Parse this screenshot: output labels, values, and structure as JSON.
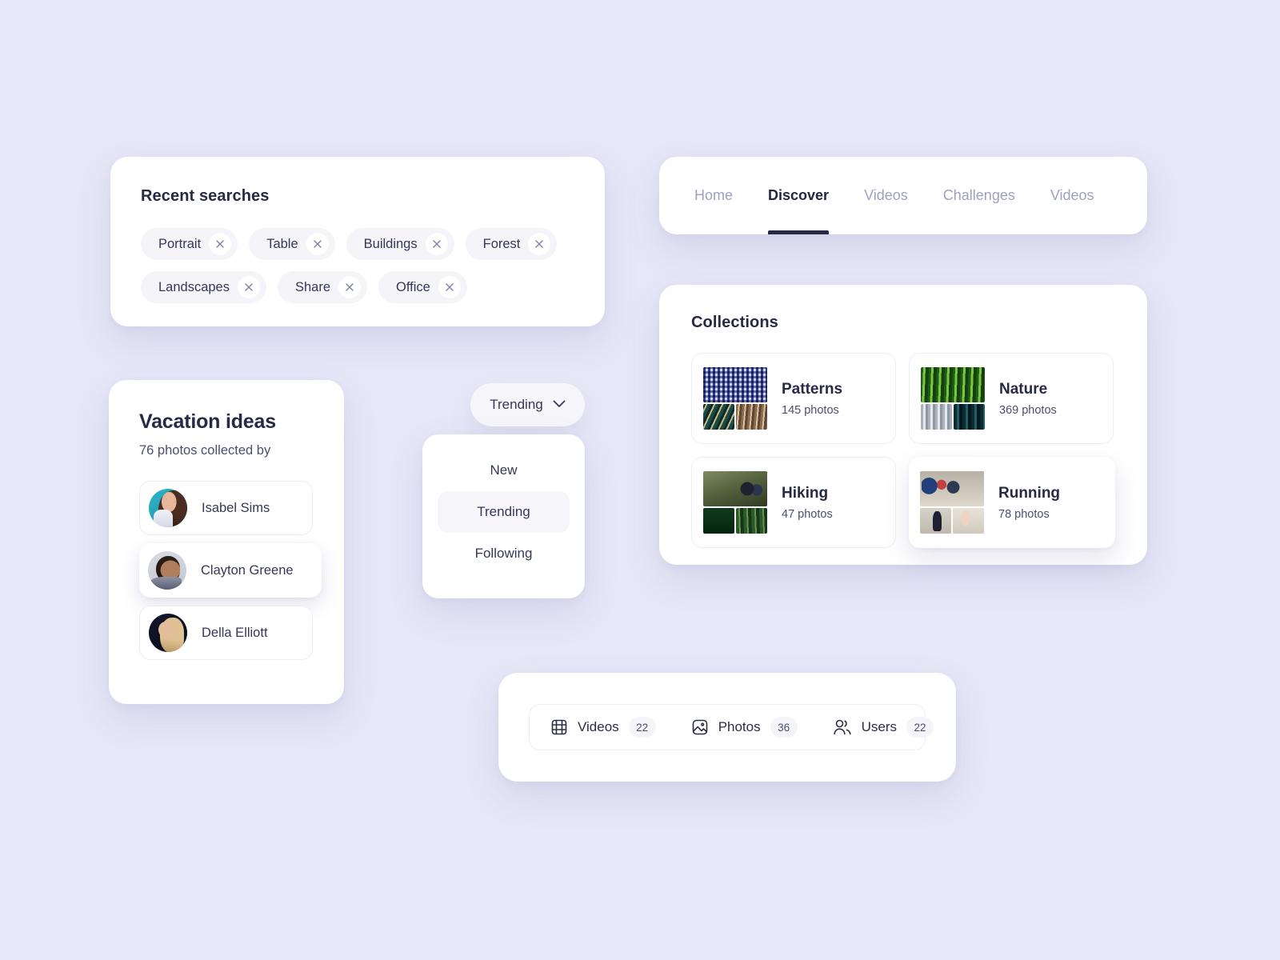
{
  "theme": {
    "background": "#e7e7f8",
    "card_background": "#ffffff",
    "text_primary": "#262a45",
    "text_secondary": "#4a4f6e",
    "text_muted": "#9ea2c0",
    "chip_background": "#f4f4f9",
    "accent": "#262a45"
  },
  "recent_searches": {
    "title": "Recent searches",
    "chips": [
      {
        "label": "Portrait",
        "close_icon": "close-icon"
      },
      {
        "label": "Table",
        "close_icon": "close-icon"
      },
      {
        "label": "Buildings",
        "close_icon": "close-icon"
      },
      {
        "label": "Forest",
        "close_icon": "close-icon"
      },
      {
        "label": "Landscapes",
        "close_icon": "close-icon"
      },
      {
        "label": "Share",
        "close_icon": "close-icon"
      },
      {
        "label": "Office",
        "close_icon": "close-icon"
      }
    ]
  },
  "vacation": {
    "title": "Vacation ideas",
    "subtitle": "76 photos collected by",
    "people": [
      {
        "name": "Isabel Sims",
        "avatar": "avatar-isabel-sims"
      },
      {
        "name": "Clayton Greene",
        "avatar": "avatar-clayton-greene"
      },
      {
        "name": "Della Elliott",
        "avatar": "avatar-della-elliott"
      }
    ]
  },
  "sort": {
    "selected": "Trending",
    "chevron_icon": "chevron-down-icon",
    "options": [
      {
        "label": "New",
        "selected": false
      },
      {
        "label": "Trending",
        "selected": true
      },
      {
        "label": "Following",
        "selected": false
      }
    ]
  },
  "nav": {
    "tabs": [
      {
        "label": "Home",
        "active": false
      },
      {
        "label": "Discover",
        "active": true
      },
      {
        "label": "Videos",
        "active": false
      },
      {
        "label": "Challenges",
        "active": false
      },
      {
        "label": "Videos",
        "active": false
      }
    ]
  },
  "collections": {
    "title": "Collections",
    "items": [
      {
        "name": "Patterns",
        "count": "145 photos",
        "thumb": "thumb-patterns"
      },
      {
        "name": "Nature",
        "count": "369 photos",
        "thumb": "thumb-nature"
      },
      {
        "name": "Hiking",
        "count": "47 photos",
        "thumb": "thumb-hiking"
      },
      {
        "name": "Running",
        "count": "78 photos",
        "thumb": "thumb-running"
      }
    ]
  },
  "filters": {
    "items": [
      {
        "label": "Videos",
        "count": "22",
        "icon": "film-icon"
      },
      {
        "label": "Photos",
        "count": "36",
        "icon": "image-icon"
      },
      {
        "label": "Users",
        "count": "22",
        "icon": "users-icon"
      }
    ]
  }
}
